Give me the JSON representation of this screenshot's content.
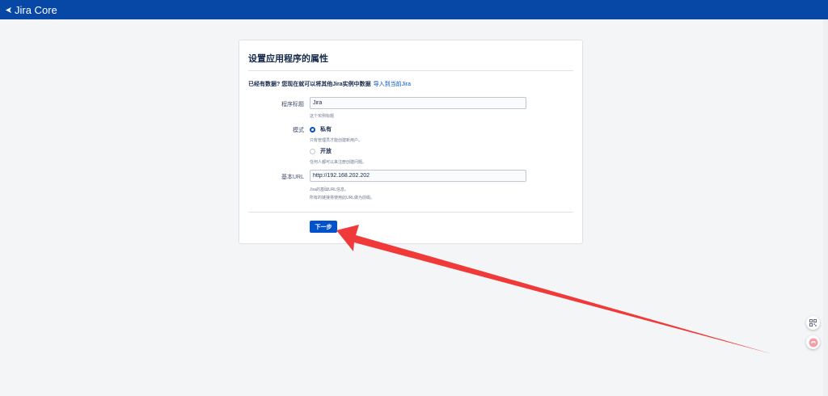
{
  "app": {
    "logo_text": "Jira Core"
  },
  "card": {
    "title": "设置应用程序的属性",
    "notice_text": "已经有数据? 您现在就可以将其他Jira实例中数据",
    "notice_link": "导入到当前Jira"
  },
  "form": {
    "app_title_label": "程序标题",
    "app_title_value": "Jira",
    "app_title_hint": "这个实例标题",
    "mode_label": "模式",
    "mode_private_label": "私有",
    "mode_private_hint": "只有管理员才能创建新用户。",
    "mode_public_label": "开放",
    "mode_public_hint": "任何人都可以来注册创建问题。",
    "mode_selected": "私有",
    "base_url_label": "基本URL",
    "base_url_value": "http://192.168.202.202",
    "base_url_hint_1": "Jira的基础URL信息。",
    "base_url_hint_2": "所有的链接将使用此URL做为前缀。",
    "next_button": "下一步"
  },
  "colors": {
    "topbar": "#0747a6",
    "primary": "#0052cc",
    "annotation_arrow": "#f03a3a"
  },
  "icons": [
    "jira-logo-icon",
    "qr-grid-icon",
    "floating-helper-icon"
  ]
}
